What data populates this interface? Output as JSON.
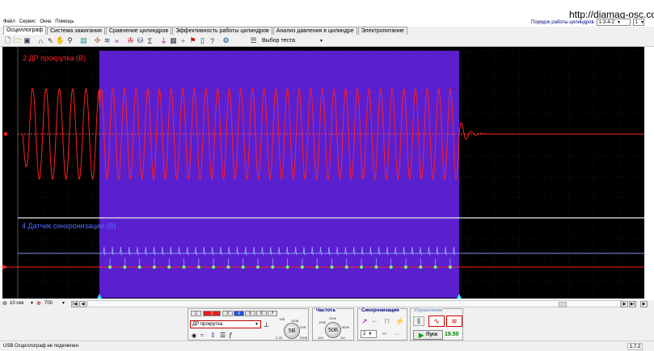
{
  "menu": {
    "items": [
      "Файл",
      "Сервис",
      "Окна",
      "Помощь"
    ]
  },
  "site_link": "http://diamag-osc.com",
  "cylinder_order": {
    "label": "Порядок работы цилиндров",
    "value": "1-3-4-2",
    "count": "1"
  },
  "tabs": [
    "Осциллограф",
    "Система зажигания",
    "Сравнение цилиндров",
    "Эффективность работы цилиндров",
    "Анализ давления в цилиндре",
    "Электропитание"
  ],
  "toolbar": {
    "test_select": "Выбор теста"
  },
  "channels": {
    "ch1": {
      "label": "2 ДР прокрутка (В)",
      "color": "#ff2020"
    },
    "ch2": {
      "label": "4 Датчик синхронизации (В)",
      "color": "#4f6bff"
    }
  },
  "colors": {
    "selection": "#5a1fcf",
    "grid": "#444444"
  },
  "scroll": {
    "timebase": "10 сек",
    "zoom": "700"
  },
  "bottom": {
    "channel_buttons": [
      "1",
      "2",
      "3",
      "4",
      "5",
      "6",
      "7"
    ],
    "channel_name": "ДР прокрутка",
    "voltage_knob": "5В",
    "voltage_ticks": [
      "10В",
      "100В",
      "20В",
      "0.1В",
      "500В"
    ],
    "frequency_title": "Частота",
    "frequency_knob": "50К",
    "frequency_ticks": [
      "250К",
      "100К",
      "500К",
      "1М",
      "10K"
    ],
    "sync_title": "Синхронизация",
    "sync_channel": "2",
    "control_title": "Управление",
    "start_label": "Пуск",
    "counter": "19.50"
  },
  "status": {
    "text": "USB Осциллограф не подключен",
    "version": "1.7.2"
  }
}
